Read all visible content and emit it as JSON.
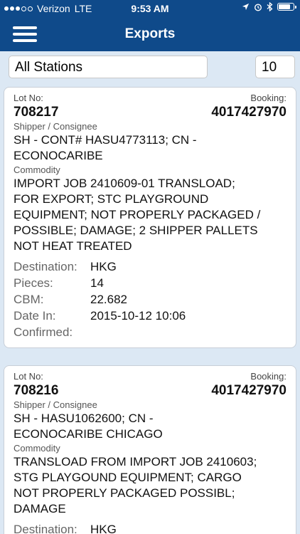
{
  "status_bar": {
    "carrier": "Verizon",
    "network": "LTE",
    "time": "9:53 AM",
    "location_icon": "location-arrow-icon",
    "alarm_icon": "alarm-icon",
    "bluetooth_icon": "bluetooth-icon",
    "battery_level": 0.85
  },
  "nav": {
    "title": "Exports",
    "menu_icon": "hamburger-menu-icon"
  },
  "filter": {
    "station": "All Stations",
    "count": "10"
  },
  "labels": {
    "lot_no": "Lot No:",
    "booking": "Booking:",
    "shipper_consignee": "Shipper / Consignee",
    "commodity": "Commodity",
    "destination": "Destination:",
    "pieces": "Pieces:",
    "cbm": "CBM:",
    "date_in": "Date In:",
    "confirmed": "Confirmed:"
  },
  "exports": [
    {
      "lot_no": "708217",
      "booking": "4017427970",
      "shipper_lines": [
        "SH - CONT# HASU4773113; CN -",
        "ECONOCARIBE"
      ],
      "commodity_lines": [
        "IMPORT JOB 2410609-01 TRANSLOAD;",
        "FOR EXPORT; STC PLAYGROUND",
        "EQUIPMENT; NOT PROPERLY PACKAGED /",
        "POSSIBLE; DAMAGE; 2 SHIPPER PALLETS",
        "NOT HEAT TREATED"
      ],
      "destination": "HKG",
      "pieces": "14",
      "cbm": "22.682",
      "date_in": "2015-10-12 10:06",
      "confirmed": ""
    },
    {
      "lot_no": "708216",
      "booking": "4017427970",
      "shipper_lines": [
        "SH - HASU1062600; CN -",
        "ECONOCARIBE CHICAGO"
      ],
      "commodity_lines": [
        "TRANSLOAD FROM IMPORT JOB 2410603;",
        "STG PLAYGOUND EQUIPMENT; CARGO",
        "NOT PROPERLY PACKAGED POSSIBL;",
        "DAMAGE"
      ],
      "destination": "HKG",
      "pieces": "",
      "cbm": "",
      "date_in": "",
      "confirmed": ""
    }
  ]
}
